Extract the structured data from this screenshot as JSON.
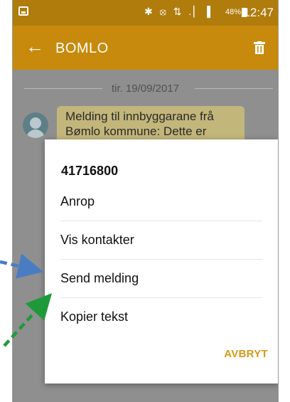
{
  "status_bar": {
    "icons": "✱ ⦻ ⇅ .▏▐",
    "battery_percent": "48%",
    "time": "12:47"
  },
  "app_bar": {
    "back_icon": "arrow-left-icon",
    "title": "BOMLO",
    "trash_icon": "trash-icon"
  },
  "conversation": {
    "date": "tir. 19/09/2017",
    "message": "Melding til innbyggarane frå Bømlo kommune: Dette er"
  },
  "dialog": {
    "number": "41716800",
    "items": [
      {
        "label": "Anrop"
      },
      {
        "label": "Vis kontakter"
      },
      {
        "label": "Send melding"
      },
      {
        "label": "Kopier tekst"
      }
    ],
    "cancel_label": "AVBRYT"
  },
  "colors": {
    "status_bar": "#b07c0c",
    "app_bar": "#c78a0d",
    "accent": "#d59a16",
    "arrow_blue": "#4a7cc2",
    "arrow_green": "#1f9a3a"
  }
}
